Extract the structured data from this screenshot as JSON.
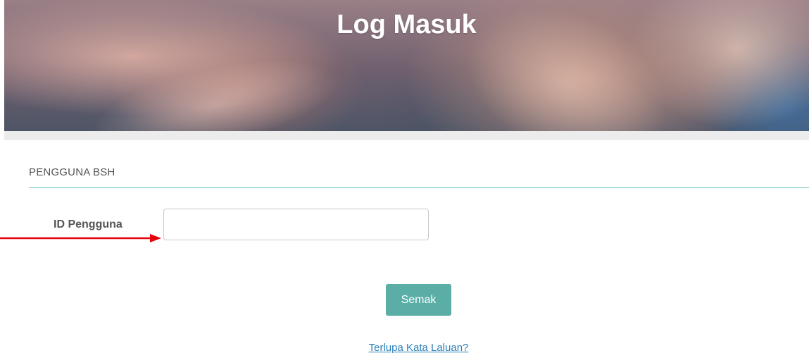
{
  "header": {
    "title": "Log Masuk"
  },
  "section": {
    "title": "PENGGUNA BSH"
  },
  "form": {
    "user_id_label": "ID Pengguna",
    "user_id_value": "",
    "user_id_placeholder": ""
  },
  "actions": {
    "check_label": "Semak",
    "forgot_password_label": "Terlupa Kata Laluan?"
  },
  "colors": {
    "accent": "#5aaea6",
    "divider": "#6fc3bf",
    "link": "#2a7fb8",
    "annotation_arrow": "#e8000b"
  },
  "annotations": {
    "arrow_icon": "right-arrow-icon"
  }
}
